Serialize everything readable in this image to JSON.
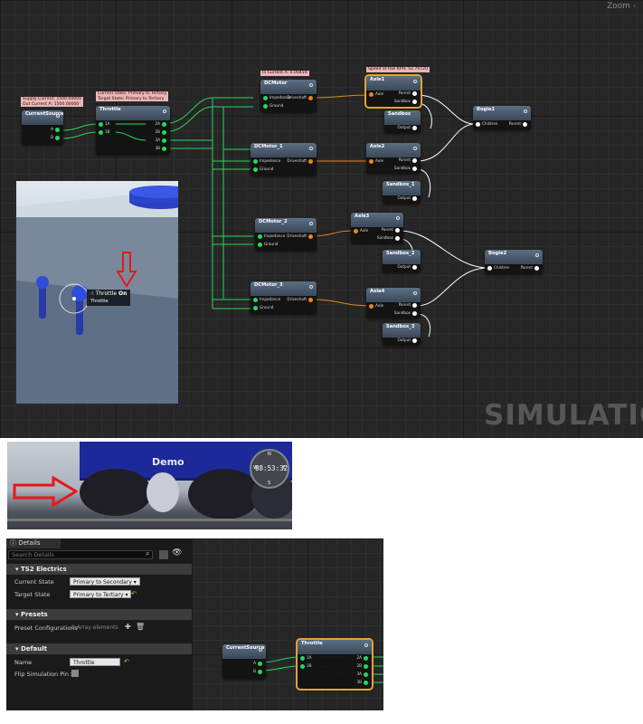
{
  "graph": {
    "zoom_label": "Zoom -",
    "watermark": "SIMULATION",
    "comments": {
      "supply": "Supply Current: 1500.00000",
      "out": "Out Current A: 1500.00000",
      "current_state": "Current State: Primary to Tertiary",
      "target_state": "Target State: Primary to Tertiary",
      "in_current": "In Current A: 0.00459",
      "speed": "Speed at Rail KPH: 52.70720"
    },
    "nodes": {
      "current_source": {
        "title": "CurrentSource",
        "subtitle": "",
        "pins": [
          "A",
          "B"
        ]
      },
      "throttle": {
        "title": "Throttle",
        "subtitle": "",
        "in_pins": [
          "1A",
          "1B"
        ],
        "out_pins": [
          "2A",
          "2B",
          "3A",
          "3B"
        ]
      },
      "dcmotor": {
        "title": "DCMotor",
        "subtitle": "",
        "pins": [
          "Impedance",
          "Ground"
        ],
        "out": "Driveshaft"
      },
      "dcmotor_1": {
        "title": "DCMotor_1",
        "subtitle": "",
        "pins": [
          "Impedance",
          "Ground"
        ],
        "out": "Driveshaft"
      },
      "dcmotor_2": {
        "title": "DCMotor_2",
        "subtitle": "",
        "pins": [
          "Impedance",
          "Ground"
        ],
        "out": "Driveshaft"
      },
      "dcmotor_3": {
        "title": "DCMotor_3",
        "subtitle": "",
        "pins": [
          "Impedance",
          "Ground"
        ],
        "out": "Driveshaft"
      },
      "axle1": {
        "title": "Axle1",
        "subtitle": "",
        "in": "Axle",
        "outs": [
          "Parent",
          "Sandbox"
        ]
      },
      "axle2": {
        "title": "Axle2",
        "subtitle": "",
        "in": "Axle",
        "outs": [
          "Parent",
          "Sandbox"
        ]
      },
      "axle3": {
        "title": "Axle3",
        "subtitle": "",
        "in": "Axle",
        "outs": [
          "Parent",
          "Sandbox"
        ]
      },
      "axle4": {
        "title": "Axle4",
        "subtitle": "",
        "in": "Axle",
        "outs": [
          "Parent",
          "Sandbox"
        ]
      },
      "sandbox": {
        "title": "Sandbox",
        "subtitle": "",
        "out": "Output"
      },
      "sandbox_1": {
        "title": "Sandbox_1",
        "subtitle": "",
        "out": "Output"
      },
      "sandbox_2": {
        "title": "Sandbox_2",
        "subtitle": "",
        "out": "Output"
      },
      "sandbox_3": {
        "title": "Sandbox_3",
        "subtitle": "",
        "out": "Output"
      },
      "bogie1": {
        "title": "Bogie1",
        "subtitle": "",
        "in": "Children",
        "out": "Parent"
      },
      "bogie2": {
        "title": "Bogie2",
        "subtitle": "",
        "in": "Children",
        "out": "Parent"
      }
    }
  },
  "viewport": {
    "interact_label": "Throttle",
    "interact_state": "On",
    "interact_sub": "Throttle"
  },
  "train_view": {
    "car_text": "Demo",
    "clock": "08:53:32",
    "compass": [
      "N",
      "E",
      "S",
      "W"
    ]
  },
  "details": {
    "tab_label": "Details",
    "search_placeholder": "Search Details",
    "sections": {
      "ts2": "TS2 Electrics",
      "presets": "Presets",
      "default": "Default"
    },
    "current_state_label": "Current State",
    "current_state_value": "Primary to Secondary",
    "target_state_label": "Target State",
    "target_state_value": "Primary to Tertiary",
    "preset_label": "Preset Configurations",
    "preset_value": "0 Array elements",
    "name_label": "Name",
    "name_value": "Throttle",
    "flip_label": "Flip Simulation Pin Si"
  },
  "colors": {
    "electric_wire": "#27d85a",
    "mechanical_wire": "#e8851e",
    "sandbox_wire": "#ffffff",
    "selection": "#e2a23a"
  }
}
